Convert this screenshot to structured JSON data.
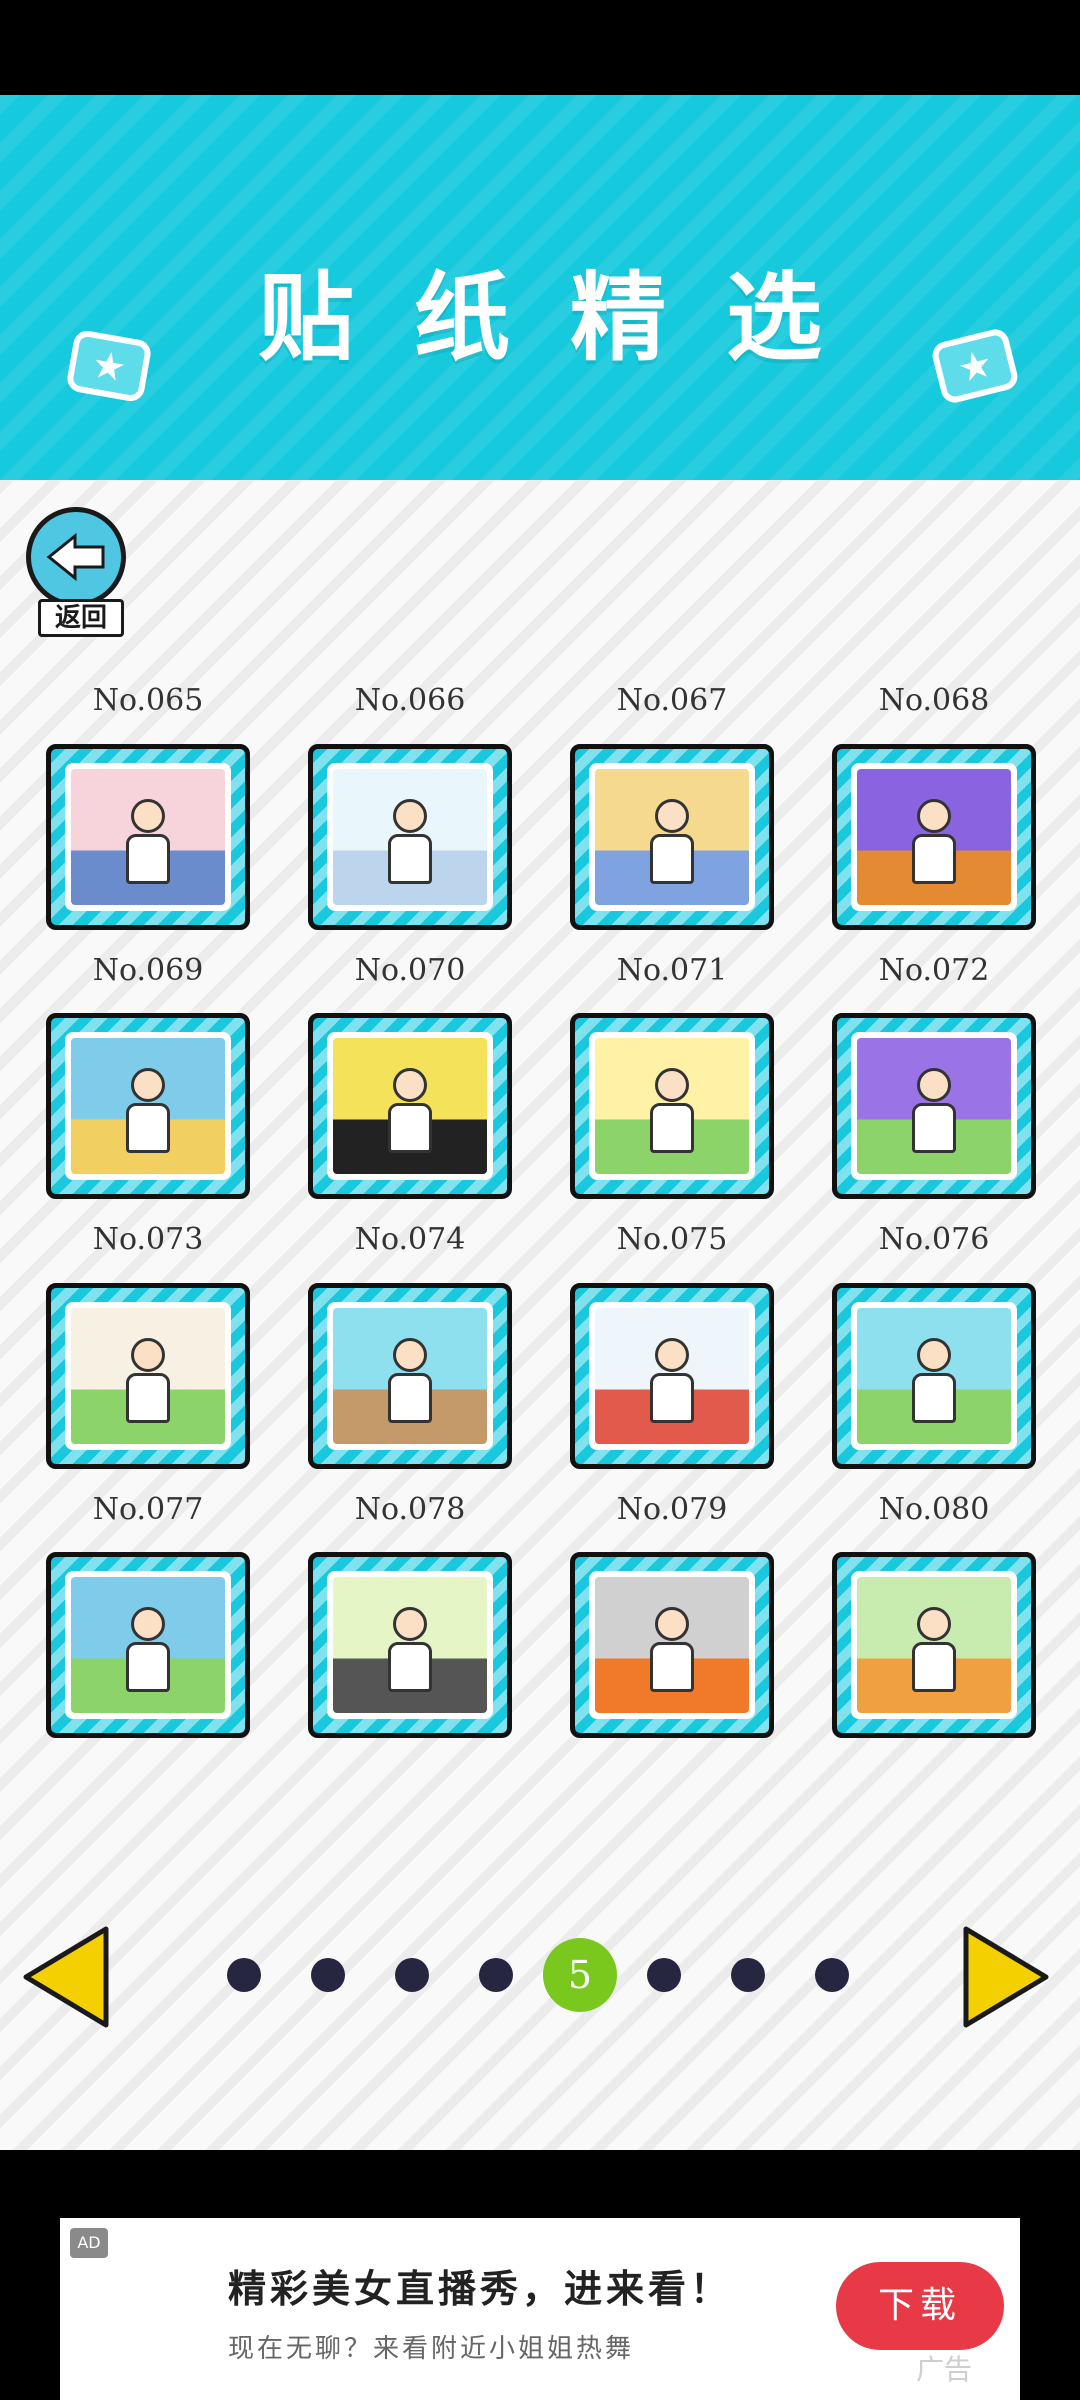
{
  "header": {
    "title": "贴纸精选"
  },
  "back_button": {
    "label": "返回"
  },
  "stickers": [
    {
      "label": "No.065",
      "scene": "couple"
    },
    {
      "label": "No.066",
      "scene": "boy-portrait"
    },
    {
      "label": "No.067",
      "scene": "running"
    },
    {
      "label": "No.068",
      "scene": "halloween-party"
    },
    {
      "label": "No.069",
      "scene": "classroom-skeleton"
    },
    {
      "label": "No.070",
      "scene": "skeleton"
    },
    {
      "label": "No.071",
      "scene": "pumpkin-boy"
    },
    {
      "label": "No.072",
      "scene": "castle-boy"
    },
    {
      "label": "No.073",
      "scene": "classroom-teacher"
    },
    {
      "label": "No.074",
      "scene": "ghost-student"
    },
    {
      "label": "No.075",
      "scene": "desk-boy"
    },
    {
      "label": "No.076",
      "scene": "desk-reading"
    },
    {
      "label": "No.077",
      "scene": "class-group"
    },
    {
      "label": "No.078",
      "scene": "street"
    },
    {
      "label": "No.079",
      "scene": "manhole"
    },
    {
      "label": "No.080",
      "scene": "snack-boy"
    }
  ],
  "pagination": {
    "current_page": "5",
    "total_dots": 8,
    "prev_icon": "yellow-left-triangle",
    "next_icon": "yellow-right-triangle"
  },
  "ad": {
    "badge": "AD",
    "headline": "精彩美女直播秀，进来看！",
    "subline": "现在无聊？来看附近小姐姐热舞",
    "cta": "下载",
    "brand": "广告"
  },
  "colors": {
    "header": "#16c9dc",
    "active_dot": "#7ac81e",
    "dot": "#262641",
    "arrow": "#f5d000",
    "ad_button": "#e83a46"
  }
}
